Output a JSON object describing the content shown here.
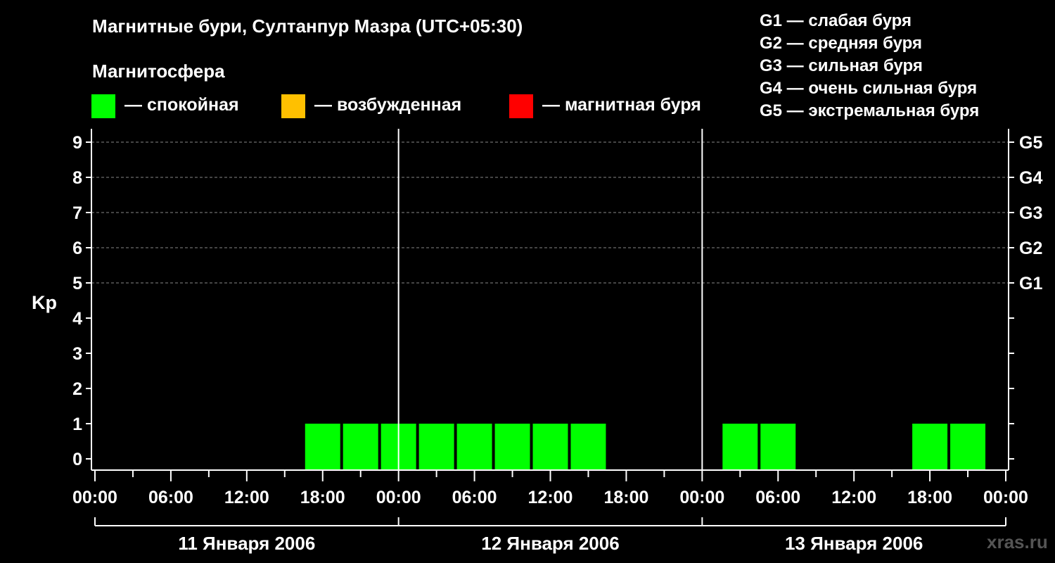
{
  "chart_data": {
    "type": "bar",
    "title": "Магнитные бури, Султанпур Мазра (UTC+05:30)",
    "ylabel": "Kp",
    "ylim": [
      0,
      9
    ],
    "y_ticks": [
      "0",
      "1",
      "2",
      "3",
      "4",
      "5",
      "6",
      "7",
      "8",
      "9"
    ],
    "right_ticks": [
      {
        "kp": 5,
        "label": "G1"
      },
      {
        "kp": 6,
        "label": "G2"
      },
      {
        "kp": 7,
        "label": "G3"
      },
      {
        "kp": 8,
        "label": "G4"
      },
      {
        "kp": 9,
        "label": "G5"
      }
    ],
    "x_tick_labels": [
      "00:00",
      "06:00",
      "12:00",
      "18:00",
      "00:00",
      "06:00",
      "12:00",
      "18:00",
      "00:00",
      "06:00",
      "12:00",
      "18:00",
      "00:00"
    ],
    "days": [
      "11 Января 2006",
      "12 Января 2006",
      "13 Января 2006"
    ],
    "interval_hours": 3,
    "bar_start_hours": [
      16.5,
      19.5,
      22.5,
      25.5,
      28.5,
      31.5,
      34.5,
      37.5,
      49.5,
      52.5,
      64.5,
      67.5
    ],
    "values": [
      1,
      1,
      1,
      1,
      1,
      1,
      1,
      1,
      1,
      1,
      1,
      1
    ],
    "grid": "dashed at Kp 5–9",
    "colors": {
      "quiet": "#00ff00",
      "excited": "#ffc000",
      "storm": "#ff0000",
      "grid": "#888888",
      "axis": "#ffffff"
    }
  },
  "magnetosphere": {
    "title": "Магнитосфера",
    "legend": [
      {
        "label": "— спокойная",
        "color": "#00ff00"
      },
      {
        "label": "— возбужденная",
        "color": "#ffc000"
      },
      {
        "label": "— магнитная буря",
        "color": "#ff0000"
      }
    ]
  },
  "storm_scale": [
    "G1 — слабая буря",
    "G2 — средняя буря",
    "G3 — сильная буря",
    "G4 — очень сильная буря",
    "G5 — экстремальная буря"
  ],
  "watermark": "xras.ru"
}
